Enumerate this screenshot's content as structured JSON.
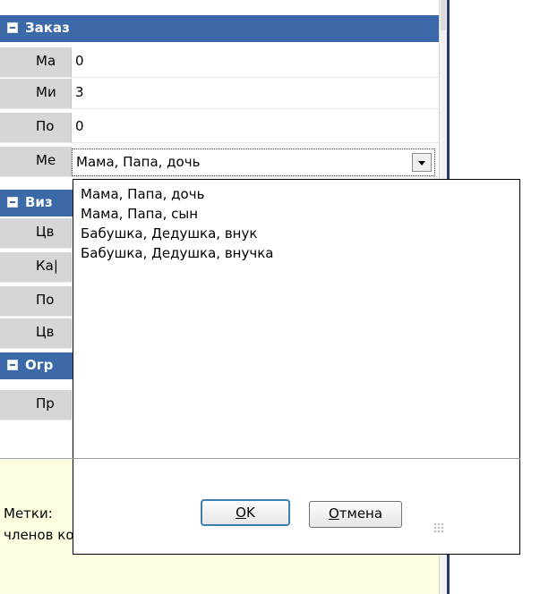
{
  "categories": [
    {
      "label": "Заказ"
    },
    {
      "label": "Виз"
    },
    {
      "label": "Огр"
    }
  ],
  "properties": [
    {
      "name": "Ма",
      "value": "0"
    },
    {
      "name": "Ми",
      "value": "3"
    },
    {
      "name": "По",
      "value": "0"
    },
    {
      "name": "Ме",
      "value": "Мама, Папа, дочь"
    },
    {
      "name": "Цв",
      "value": ""
    },
    {
      "name": "Ка|",
      "value": ""
    },
    {
      "name": "По",
      "value": ""
    },
    {
      "name": "Цв",
      "value": ""
    },
    {
      "name": "Пр",
      "value": ""
    }
  ],
  "dropdown": {
    "current_value": "Мама, Папа, дочь",
    "options": [
      "Мама, Папа, дочь",
      "Мама, Папа, сын",
      "Бабушка, Дедушка, внук",
      "Бабушка, Дедушка, внучка"
    ],
    "ok_label": "OK",
    "ok_mnemonic": "O",
    "ok_rest": "K",
    "cancel_mnemonic": "О",
    "cancel_rest": "тмена"
  },
  "help": {
    "title": "Метки:",
    "description": "членов компании гостей такого типа"
  },
  "colors": {
    "category_bg": "#3c6aa8",
    "help_bg": "#ffffe1",
    "accent_border": "#3c7fb1"
  }
}
